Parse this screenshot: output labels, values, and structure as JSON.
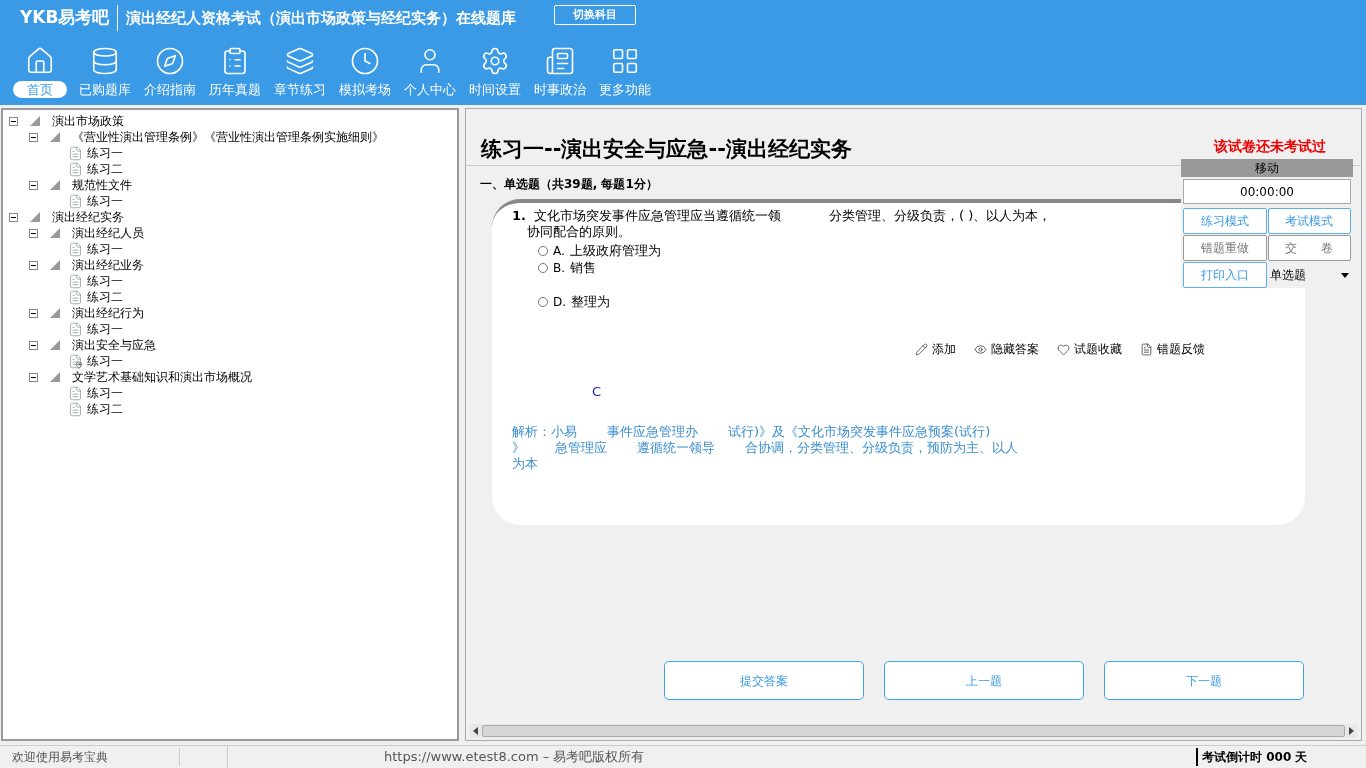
{
  "header": {
    "logo": "YKB易考吧",
    "title": "演出经纪人资格考试（演出市场政策与经纪实务）在线题库",
    "switch_button": "切换科目"
  },
  "nav": [
    {
      "label": "首页",
      "selected": true
    },
    {
      "label": "已购题库",
      "selected": false
    },
    {
      "label": "介绍指南",
      "selected": false
    },
    {
      "label": "历年真题",
      "selected": false
    },
    {
      "label": "章节练习",
      "selected": false
    },
    {
      "label": "模拟考场",
      "selected": false
    },
    {
      "label": "个人中心",
      "selected": false
    },
    {
      "label": "时间设置",
      "selected": false
    },
    {
      "label": "时事政治",
      "selected": false
    },
    {
      "label": "更多功能",
      "selected": false
    }
  ],
  "tree": [
    {
      "label": "演出市场政策",
      "expanded": true,
      "children": [
        {
          "label": "《营业性演出管理条例》《营业性演出管理条例实施细则》",
          "expanded": true,
          "children": [
            {
              "label": "练习一",
              "selected": false
            },
            {
              "label": "练习二",
              "selected": false
            }
          ]
        },
        {
          "label": "规范性文件",
          "expanded": true,
          "children": [
            {
              "label": "练习一",
              "selected": false
            }
          ]
        }
      ]
    },
    {
      "label": "演出经纪实务",
      "expanded": true,
      "children": [
        {
          "label": "演出经纪人员",
          "expanded": true,
          "children": [
            {
              "label": "练习一",
              "selected": false
            }
          ]
        },
        {
          "label": "演出经纪业务",
          "expanded": true,
          "children": [
            {
              "label": "练习一",
              "selected": false
            },
            {
              "label": "练习二",
              "selected": false
            }
          ]
        },
        {
          "label": "演出经纪行为",
          "expanded": true,
          "children": [
            {
              "label": "练习一",
              "selected": false
            }
          ]
        },
        {
          "label": "演出安全与应急",
          "expanded": true,
          "children": [
            {
              "label": "练习一",
              "selected": true
            }
          ]
        },
        {
          "label": "文学艺术基础知识和演出市场概况",
          "expanded": true,
          "children": [
            {
              "label": "练习一",
              "selected": false
            },
            {
              "label": "练习二",
              "selected": false
            }
          ]
        }
      ]
    }
  ],
  "exam": {
    "title": "练习一--演出安全与应急--演出经纪实务",
    "status": "该试卷还未考试过",
    "section": "一、单选题（共39题, 每题1分）",
    "question": {
      "number": "1.",
      "line1": [
        "文化市场突发事件应急管理应当遵循统一领",
        "分类管理、分级负责，( )、以人为本，"
      ],
      "line2": "协同配合的原则。",
      "options": [
        {
          "label": "A.",
          "text": "上级政府管理为",
          "selected": false
        },
        {
          "label": "B.",
          "text": "销售",
          "selected": false
        },
        {
          "label": "D.",
          "text": "整理为",
          "selected": false
        }
      ]
    },
    "actions": [
      "添加",
      "隐藏答案",
      "试题收藏",
      "错题反馈"
    ],
    "answer": "C",
    "analysis": [
      [
        "解析：小易",
        "事件应急管理办",
        "试行)》及《文化市场突发事件应急预案(试行)"
      ],
      [
        "》",
        "急管理应",
        "遵循统一领导",
        "合协调，分类管理、分级负责，预防为主、以人"
      ],
      [
        "为本"
      ]
    ],
    "buttons": [
      "提交答案",
      "上一题",
      "下一题"
    ]
  },
  "float_panel": {
    "title": "移动",
    "timer": "00:00:00",
    "buttons": [
      {
        "label": "练习模式",
        "kind": "blue"
      },
      {
        "label": "考试模式",
        "kind": "blue"
      },
      {
        "label": "错题重做",
        "kind": "gray"
      },
      {
        "label": "交　　卷",
        "kind": "gray"
      },
      {
        "label": "打印入口",
        "kind": "blue"
      }
    ],
    "select": "单选题"
  },
  "status_bar": {
    "welcome": "欢迎使用易考宝典",
    "copyright": "https://www.etest8.com – 易考吧版权所有",
    "countdown": "考试倒计时 000 天"
  }
}
